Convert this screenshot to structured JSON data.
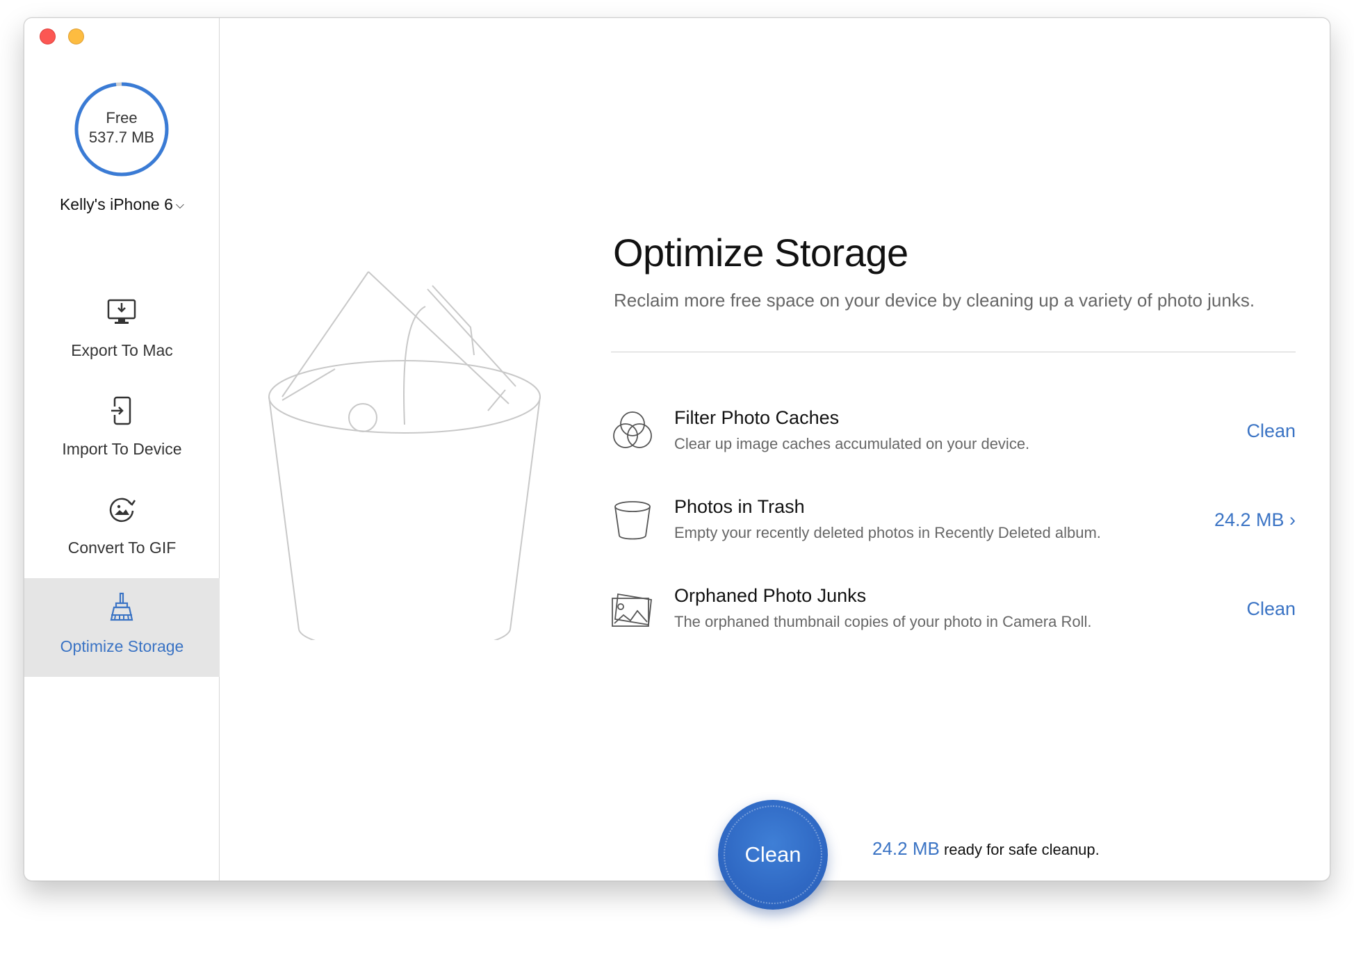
{
  "sidebar": {
    "storage": {
      "label": "Free",
      "value": "537.7 MB",
      "used_fraction": 0.98
    },
    "device_name": "Kelly's iPhone 6",
    "nav": [
      {
        "label": "Export To Mac",
        "icon": "monitor-download-icon"
      },
      {
        "label": "Import To Device",
        "icon": "phone-import-icon"
      },
      {
        "label": "Convert To GIF",
        "icon": "gif-convert-icon"
      },
      {
        "label": "Optimize Storage",
        "icon": "broom-icon",
        "active": true
      }
    ]
  },
  "main": {
    "title": "Optimize Storage",
    "subtitle": "Reclaim more free space on your device by cleaning up a variety of photo junks.",
    "items": [
      {
        "title": "Filter Photo Caches",
        "description": "Clear up image caches accumulated on your device.",
        "action": "Clean",
        "icon": "overlapping-circles-icon"
      },
      {
        "title": "Photos in Trash",
        "description": "Empty your recently deleted photos in Recently Deleted album.",
        "action": "24.2 MB ›",
        "icon": "trash-bin-icon"
      },
      {
        "title": "Orphaned Photo Junks",
        "description": "The orphaned thumbnail copies of your photo in Camera Roll.",
        "action": "Clean",
        "icon": "photo-stack-icon"
      }
    ],
    "clean_button": "Clean",
    "summary": {
      "size": "24.2 MB",
      "text": "ready for safe cleanup."
    }
  },
  "colors": {
    "accent": "#3a73c4",
    "ring": "#3a7bd5",
    "close": "#fc5753",
    "minimize": "#fdbc40"
  }
}
